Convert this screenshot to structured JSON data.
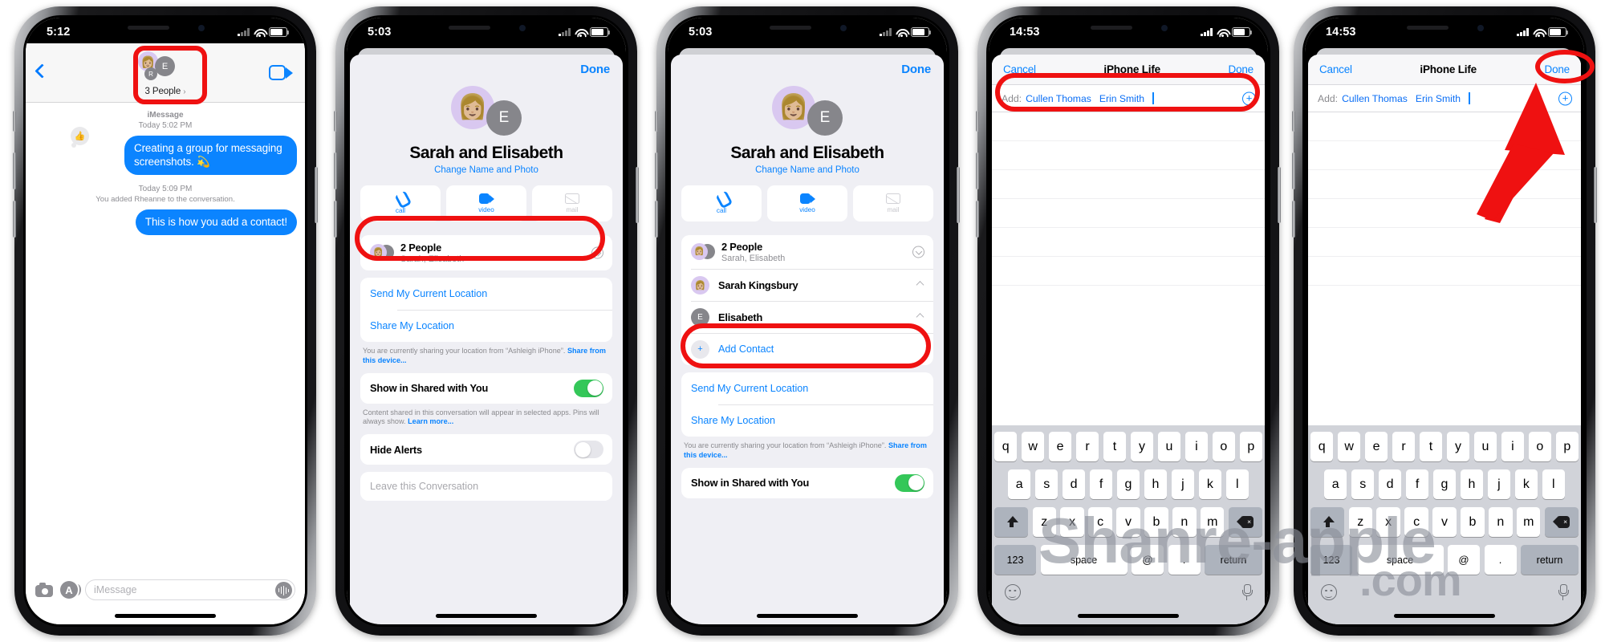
{
  "watermark": {
    "line1": "Shanre-apple",
    "line2": ".com"
  },
  "phones": [
    {
      "id": "phone-1-conversation",
      "status": {
        "time": "5:12"
      },
      "nav": {
        "group_label": "3 People",
        "chevron": "›"
      },
      "conversation": {
        "service_line": "iMessage",
        "first_timestamp": "Today 5:02 PM",
        "bubble1": "Creating a group for messaging screenshots. 💫",
        "tapback": "👍",
        "second_timestamp": "Today 5:09 PM",
        "system_note": "You added Rheanne  to the conversation.",
        "bubble2": "This is how you add a contact!"
      },
      "toolbar": {
        "imessage_placeholder": "iMessage"
      }
    },
    {
      "id": "phone-2-details",
      "status": {
        "time": "5:03"
      },
      "sheet": {
        "done_label": "Done",
        "group_name": "Sarah and Elisabeth",
        "change_link": "Change Name and Photo",
        "actions": [
          {
            "label": "call",
            "icon": "phone-icon",
            "enabled": true
          },
          {
            "label": "video",
            "icon": "video-icon",
            "enabled": true
          },
          {
            "label": "mail",
            "icon": "mail-icon",
            "enabled": false
          }
        ],
        "people_row": {
          "title": "2 People",
          "subtitle": "Sarah, Elisabeth"
        },
        "send_location": "Send My Current Location",
        "share_location": "Share My Location",
        "location_note_pre": "You are currently sharing your location from “Ashleigh iPhone”. ",
        "location_note_link": "Share from this device...",
        "shared_with_you_label": "Show in Shared with You",
        "shared_with_you_on": true,
        "shared_note_pre": "Content shared in this conversation will appear in selected apps. Pins will always show. ",
        "shared_note_link": "Learn more...",
        "hide_alerts_label": "Hide Alerts",
        "hide_alerts_on": false,
        "leave_label": "Leave this Conversation"
      }
    },
    {
      "id": "phone-3-details-expanded",
      "status": {
        "time": "5:03"
      },
      "sheet": {
        "done_label": "Done",
        "group_name": "Sarah and Elisabeth",
        "change_link": "Change Name and Photo",
        "actions": [
          {
            "label": "call",
            "icon": "phone-icon",
            "enabled": true
          },
          {
            "label": "video",
            "icon": "video-icon",
            "enabled": true
          },
          {
            "label": "mail",
            "icon": "mail-icon",
            "enabled": false
          }
        ],
        "people_row": {
          "title": "2 People",
          "subtitle": "Sarah, Elisabeth"
        },
        "members": [
          {
            "name": "Sarah Kingsbury",
            "avatar": "memoji"
          },
          {
            "name": "Elisabeth",
            "avatar": "E"
          }
        ],
        "add_contact_label": "Add Contact",
        "add_contact_icon": "plus-icon",
        "send_location": "Send My Current Location",
        "share_location": "Share My Location",
        "location_note_pre": "You are currently sharing your location from “Ashleigh iPhone”. ",
        "location_note_link": "Share from this device...",
        "shared_with_you_label": "Show in Shared with You",
        "shared_with_you_on": true
      }
    },
    {
      "id": "phone-4-add-contact",
      "status": {
        "time": "14:53"
      },
      "nav": {
        "cancel": "Cancel",
        "title": "iPhone Life",
        "done": "Done"
      },
      "add_field": {
        "label": "Add:",
        "tokens": [
          "Cullen Thomas",
          "Erin Smith"
        ],
        "plus_icon": "plus-circle-icon"
      },
      "keyboard": {
        "row1": [
          "q",
          "w",
          "e",
          "r",
          "t",
          "y",
          "u",
          "i",
          "o",
          "p"
        ],
        "row2": [
          "a",
          "s",
          "d",
          "f",
          "g",
          "h",
          "j",
          "k",
          "l"
        ],
        "row3": [
          "z",
          "x",
          "c",
          "v",
          "b",
          "n",
          "m"
        ],
        "shift": "shift-icon",
        "delete": "delete-icon",
        "numbers": "123",
        "space": "space",
        "at": "@",
        "dot": ".",
        "return": "return",
        "emoji": "emoji-icon",
        "mic": "microphone-icon"
      }
    },
    {
      "id": "phone-5-add-contact-done",
      "status": {
        "time": "14:53"
      },
      "nav": {
        "cancel": "Cancel",
        "title": "iPhone Life",
        "done": "Done"
      },
      "add_field": {
        "label": "Add:",
        "tokens": [
          "Cullen Thomas",
          "Erin Smith"
        ],
        "plus_icon": "plus-circle-icon"
      },
      "keyboard": {
        "row1": [
          "q",
          "w",
          "e",
          "r",
          "t",
          "y",
          "u",
          "i",
          "o",
          "p"
        ],
        "row2": [
          "a",
          "s",
          "d",
          "f",
          "g",
          "h",
          "j",
          "k",
          "l"
        ],
        "row3": [
          "z",
          "x",
          "c",
          "v",
          "b",
          "n",
          "m"
        ],
        "shift": "shift-icon",
        "delete": "delete-icon",
        "numbers": "123",
        "space": "space",
        "at": "@",
        "dot": ".",
        "return": "return",
        "emoji": "emoji-icon",
        "mic": "microphone-icon"
      }
    }
  ],
  "colors": {
    "accent_blue": "#0a84ff",
    "bubble_blue": "#0b84ff",
    "annotation_red": "#ef1111",
    "toggle_green": "#34c759"
  }
}
